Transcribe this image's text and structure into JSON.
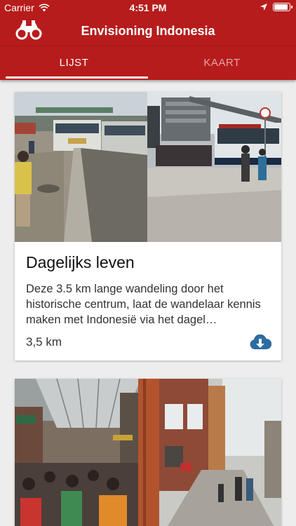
{
  "status_bar": {
    "carrier": "Carrier",
    "time": "4:51 PM",
    "battery_level": 0.95,
    "icons": [
      "wifi-icon",
      "location-arrow-icon",
      "battery-icon"
    ]
  },
  "app_bar": {
    "title": "Envisioning Indonesia",
    "icon": "binoculars-icon",
    "background_color": "#b71c1c"
  },
  "tabs": [
    {
      "label": "LIJST",
      "active": true
    },
    {
      "label": "KAART",
      "active": false
    }
  ],
  "tours": [
    {
      "title": "Dagelijks leven",
      "description": "Deze 3.5 km lange wandeling door het historische centrum, laat de wandelaar kennis maken met Indonesië via het dagel…",
      "distance": "3,5 km",
      "download_icon": "cloud-download-icon",
      "accent_color": "#2c6da0"
    },
    {
      "title": "",
      "description": "",
      "distance": ""
    }
  ]
}
